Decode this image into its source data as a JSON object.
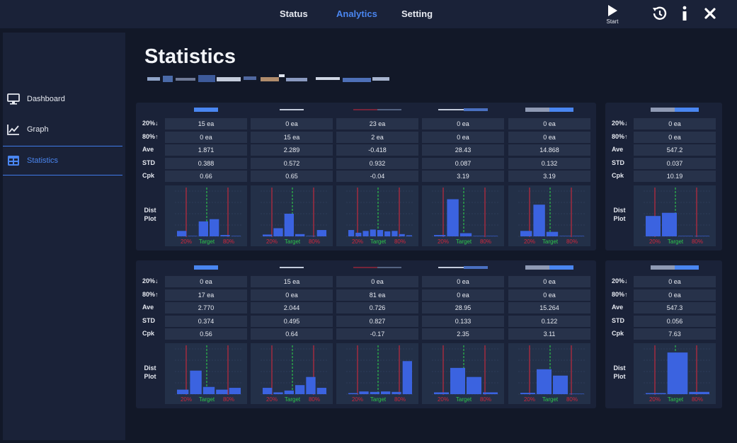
{
  "header": {
    "tabs": [
      {
        "label": "Status",
        "active": false
      },
      {
        "label": "Analytics",
        "active": true
      },
      {
        "label": "Setting",
        "active": false
      }
    ],
    "start_label": "Start",
    "icons": [
      "play-icon",
      "history-icon",
      "info-icon",
      "close-icon"
    ]
  },
  "sidebar": {
    "items": [
      {
        "label": "Dashboard",
        "icon": "monitor-icon",
        "active": false
      },
      {
        "label": "Graph",
        "icon": "line-chart-icon",
        "active": false
      },
      {
        "label": "Statistics",
        "icon": "table-icon",
        "active": true
      }
    ]
  },
  "page": {
    "title": "Statistics"
  },
  "row_labels": [
    "20%↓",
    "80%↑",
    "Ave",
    "STD",
    "Cpk"
  ],
  "dist_label": "Dist\nPlot",
  "plot_axis_labels": {
    "low": "20%",
    "target": "Target",
    "high": "80%"
  },
  "colors": {
    "background": "#121828",
    "panel": "#1a2238",
    "cell": "#27324a",
    "accent": "#4a86f0",
    "bar": "#3b63e0",
    "target_line": "#2ec84a",
    "limit_line": "#d0283c"
  },
  "groups": [
    {
      "columns": [
        {
          "values": [
            "15 ea",
            "0 ea",
            "1.871",
            "0.388",
            "0.66"
          ],
          "bars": [
            0.12,
            0,
            0.33,
            0.38,
            0.03,
            0
          ]
        },
        {
          "values": [
            "0 ea",
            "15 ea",
            "2.289",
            "0.572",
            "0.65"
          ],
          "bars": [
            0.04,
            0.18,
            0.5,
            0.05,
            0,
            0.14
          ]
        },
        {
          "values": [
            "23 ea",
            "2 ea",
            "-0.418",
            "0.932",
            "-0.04"
          ],
          "bars": [
            0.14,
            0.08,
            0.12,
            0.15,
            0.14,
            0.11,
            0.12,
            0.05,
            0.02
          ]
        },
        {
          "values": [
            "0 ea",
            "0 ea",
            "28.43",
            "0.087",
            "3.19"
          ],
          "bars": [
            0.03,
            0.82,
            0.07,
            0,
            0
          ]
        },
        {
          "values": [
            "0 ea",
            "0 ea",
            "14.868",
            "0.132",
            "3.19"
          ],
          "bars": [
            0.12,
            0.7,
            0.1,
            0,
            0
          ]
        }
      ],
      "side": {
        "values": [
          "0 ea",
          "0 ea",
          "547.2",
          "0.037",
          "10.19"
        ],
        "bars": [
          0.45,
          0.52,
          0,
          0
        ]
      }
    },
    {
      "columns": [
        {
          "values": [
            "0 ea",
            "17 ea",
            "2.770",
            "0.374",
            "0.56"
          ],
          "bars": [
            0.1,
            0.52,
            0.16,
            0.1,
            0.14
          ]
        },
        {
          "values": [
            "15 ea",
            "0 ea",
            "2.044",
            "0.495",
            "0.64"
          ],
          "bars": [
            0.14,
            0.04,
            0.08,
            0.2,
            0.38,
            0.14
          ]
        },
        {
          "values": [
            "0 ea",
            "81 ea",
            "0.726",
            "0.827",
            "-0.17"
          ],
          "bars": [
            0.02,
            0.06,
            0.05,
            0.06,
            0.05,
            0.73
          ]
        },
        {
          "values": [
            "0 ea",
            "0 ea",
            "28.95",
            "0.133",
            "2.35"
          ],
          "bars": [
            0.04,
            0.58,
            0.38,
            0.04
          ]
        },
        {
          "values": [
            "0 ea",
            "0 ea",
            "15.264",
            "0.122",
            "3.11"
          ],
          "bars": [
            0.03,
            0.55,
            0.41,
            0
          ]
        }
      ],
      "side": {
        "values": [
          "0 ea",
          "0 ea",
          "547.3",
          "0.056",
          "7.63"
        ],
        "bars": [
          0.02,
          0.92,
          0.05
        ]
      }
    }
  ]
}
